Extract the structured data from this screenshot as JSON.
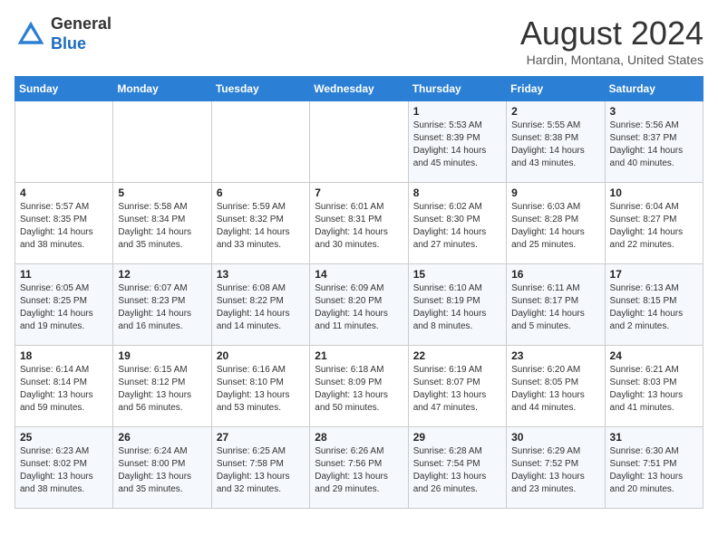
{
  "header": {
    "logo_line1": "General",
    "logo_line2": "Blue",
    "month_year": "August 2024",
    "location": "Hardin, Montana, United States"
  },
  "weekdays": [
    "Sunday",
    "Monday",
    "Tuesday",
    "Wednesday",
    "Thursday",
    "Friday",
    "Saturday"
  ],
  "weeks": [
    [
      {
        "day": "",
        "sunrise": "",
        "sunset": "",
        "daylight": ""
      },
      {
        "day": "",
        "sunrise": "",
        "sunset": "",
        "daylight": ""
      },
      {
        "day": "",
        "sunrise": "",
        "sunset": "",
        "daylight": ""
      },
      {
        "day": "",
        "sunrise": "",
        "sunset": "",
        "daylight": ""
      },
      {
        "day": "1",
        "sunrise": "Sunrise: 5:53 AM",
        "sunset": "Sunset: 8:39 PM",
        "daylight": "Daylight: 14 hours and 45 minutes."
      },
      {
        "day": "2",
        "sunrise": "Sunrise: 5:55 AM",
        "sunset": "Sunset: 8:38 PM",
        "daylight": "Daylight: 14 hours and 43 minutes."
      },
      {
        "day": "3",
        "sunrise": "Sunrise: 5:56 AM",
        "sunset": "Sunset: 8:37 PM",
        "daylight": "Daylight: 14 hours and 40 minutes."
      }
    ],
    [
      {
        "day": "4",
        "sunrise": "Sunrise: 5:57 AM",
        "sunset": "Sunset: 8:35 PM",
        "daylight": "Daylight: 14 hours and 38 minutes."
      },
      {
        "day": "5",
        "sunrise": "Sunrise: 5:58 AM",
        "sunset": "Sunset: 8:34 PM",
        "daylight": "Daylight: 14 hours and 35 minutes."
      },
      {
        "day": "6",
        "sunrise": "Sunrise: 5:59 AM",
        "sunset": "Sunset: 8:32 PM",
        "daylight": "Daylight: 14 hours and 33 minutes."
      },
      {
        "day": "7",
        "sunrise": "Sunrise: 6:01 AM",
        "sunset": "Sunset: 8:31 PM",
        "daylight": "Daylight: 14 hours and 30 minutes."
      },
      {
        "day": "8",
        "sunrise": "Sunrise: 6:02 AM",
        "sunset": "Sunset: 8:30 PM",
        "daylight": "Daylight: 14 hours and 27 minutes."
      },
      {
        "day": "9",
        "sunrise": "Sunrise: 6:03 AM",
        "sunset": "Sunset: 8:28 PM",
        "daylight": "Daylight: 14 hours and 25 minutes."
      },
      {
        "day": "10",
        "sunrise": "Sunrise: 6:04 AM",
        "sunset": "Sunset: 8:27 PM",
        "daylight": "Daylight: 14 hours and 22 minutes."
      }
    ],
    [
      {
        "day": "11",
        "sunrise": "Sunrise: 6:05 AM",
        "sunset": "Sunset: 8:25 PM",
        "daylight": "Daylight: 14 hours and 19 minutes."
      },
      {
        "day": "12",
        "sunrise": "Sunrise: 6:07 AM",
        "sunset": "Sunset: 8:23 PM",
        "daylight": "Daylight: 14 hours and 16 minutes."
      },
      {
        "day": "13",
        "sunrise": "Sunrise: 6:08 AM",
        "sunset": "Sunset: 8:22 PM",
        "daylight": "Daylight: 14 hours and 14 minutes."
      },
      {
        "day": "14",
        "sunrise": "Sunrise: 6:09 AM",
        "sunset": "Sunset: 8:20 PM",
        "daylight": "Daylight: 14 hours and 11 minutes."
      },
      {
        "day": "15",
        "sunrise": "Sunrise: 6:10 AM",
        "sunset": "Sunset: 8:19 PM",
        "daylight": "Daylight: 14 hours and 8 minutes."
      },
      {
        "day": "16",
        "sunrise": "Sunrise: 6:11 AM",
        "sunset": "Sunset: 8:17 PM",
        "daylight": "Daylight: 14 hours and 5 minutes."
      },
      {
        "day": "17",
        "sunrise": "Sunrise: 6:13 AM",
        "sunset": "Sunset: 8:15 PM",
        "daylight": "Daylight: 14 hours and 2 minutes."
      }
    ],
    [
      {
        "day": "18",
        "sunrise": "Sunrise: 6:14 AM",
        "sunset": "Sunset: 8:14 PM",
        "daylight": "Daylight: 13 hours and 59 minutes."
      },
      {
        "day": "19",
        "sunrise": "Sunrise: 6:15 AM",
        "sunset": "Sunset: 8:12 PM",
        "daylight": "Daylight: 13 hours and 56 minutes."
      },
      {
        "day": "20",
        "sunrise": "Sunrise: 6:16 AM",
        "sunset": "Sunset: 8:10 PM",
        "daylight": "Daylight: 13 hours and 53 minutes."
      },
      {
        "day": "21",
        "sunrise": "Sunrise: 6:18 AM",
        "sunset": "Sunset: 8:09 PM",
        "daylight": "Daylight: 13 hours and 50 minutes."
      },
      {
        "day": "22",
        "sunrise": "Sunrise: 6:19 AM",
        "sunset": "Sunset: 8:07 PM",
        "daylight": "Daylight: 13 hours and 47 minutes."
      },
      {
        "day": "23",
        "sunrise": "Sunrise: 6:20 AM",
        "sunset": "Sunset: 8:05 PM",
        "daylight": "Daylight: 13 hours and 44 minutes."
      },
      {
        "day": "24",
        "sunrise": "Sunrise: 6:21 AM",
        "sunset": "Sunset: 8:03 PM",
        "daylight": "Daylight: 13 hours and 41 minutes."
      }
    ],
    [
      {
        "day": "25",
        "sunrise": "Sunrise: 6:23 AM",
        "sunset": "Sunset: 8:02 PM",
        "daylight": "Daylight: 13 hours and 38 minutes."
      },
      {
        "day": "26",
        "sunrise": "Sunrise: 6:24 AM",
        "sunset": "Sunset: 8:00 PM",
        "daylight": "Daylight: 13 hours and 35 minutes."
      },
      {
        "day": "27",
        "sunrise": "Sunrise: 6:25 AM",
        "sunset": "Sunset: 7:58 PM",
        "daylight": "Daylight: 13 hours and 32 minutes."
      },
      {
        "day": "28",
        "sunrise": "Sunrise: 6:26 AM",
        "sunset": "Sunset: 7:56 PM",
        "daylight": "Daylight: 13 hours and 29 minutes."
      },
      {
        "day": "29",
        "sunrise": "Sunrise: 6:28 AM",
        "sunset": "Sunset: 7:54 PM",
        "daylight": "Daylight: 13 hours and 26 minutes."
      },
      {
        "day": "30",
        "sunrise": "Sunrise: 6:29 AM",
        "sunset": "Sunset: 7:52 PM",
        "daylight": "Daylight: 13 hours and 23 minutes."
      },
      {
        "day": "31",
        "sunrise": "Sunrise: 6:30 AM",
        "sunset": "Sunset: 7:51 PM",
        "daylight": "Daylight: 13 hours and 20 minutes."
      }
    ]
  ]
}
